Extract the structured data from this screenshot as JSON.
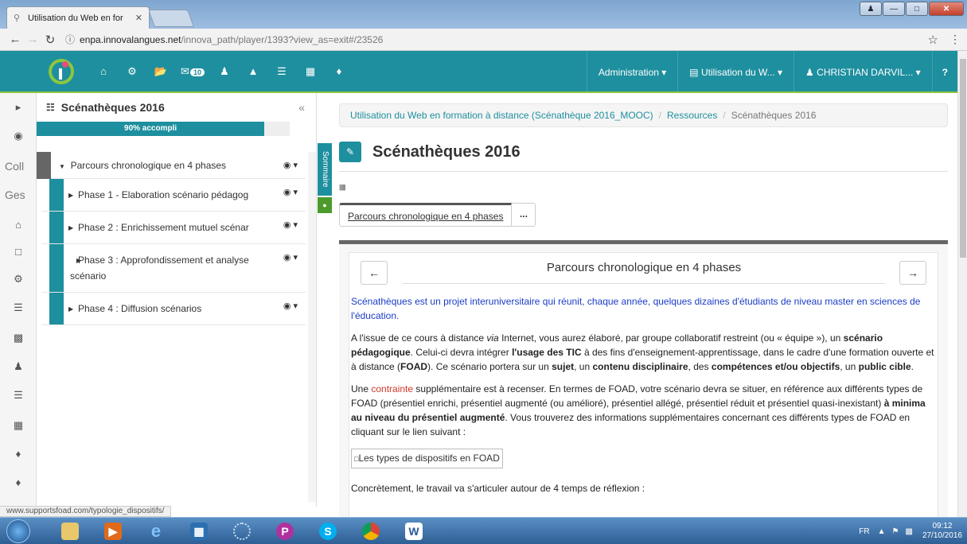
{
  "browser": {
    "tab_title": "Utilisation du Web en for",
    "url_host": "enpa.innovalangues.net",
    "url_path": "/innova_path/player/1393?view_as=exit#/23526",
    "status_url": "www.supportsfoad.com/typologie_dispositifs/"
  },
  "navbar": {
    "messages_count": "10",
    "admin_label": "Administration",
    "course_label": "Utilisation du W...",
    "user_label": "CHRISTIAN DARVIL..."
  },
  "rail": {
    "text1": "Coll",
    "text2": "Ges"
  },
  "sidebar": {
    "title": "Scénathèques 2016",
    "progress_label": "90% accompli",
    "progress_value": 90,
    "root_label": "Parcours chronologique en 4 phases",
    "items": [
      {
        "label": "Phase 1 - Elaboration scénario pédagog"
      },
      {
        "label": "Phase 2 : Enrichissement mutuel scénar"
      },
      {
        "label": "Phase 3 : Approfondissement et analyse scénario"
      },
      {
        "label": "Phase 4 : Diffusion scénarios"
      }
    ]
  },
  "sommaire_label": "Sommaire",
  "breadcrumb": {
    "item1": "Utilisation du Web en formation à distance (Scénathèque 2016_MOOC)",
    "item2": "Ressources",
    "current": "Scénathèques 2016"
  },
  "page_title": "Scénathèques 2016",
  "tab_label": "Parcours chronologique en 4 phases",
  "tab_more": "...",
  "content": {
    "title": "Parcours chronologique en 4 phases",
    "intro": "Scénathèques est un projet interuniversitaire qui réunit, chaque année, quelques dizaines d'étudiants de niveau master en sciences de l'éducation.",
    "p2_a": "A l'issue de ce cours à distance ",
    "p2_via": "via",
    "p2_b": " Internet, vous aurez élaboré, par groupe collaboratif restreint (ou « équipe »), un ",
    "p2_scenario": "scénario pédagogique",
    "p2_c": ". Celui-ci devra intégrer ",
    "p2_tic": "l'usage des TIC",
    "p2_d": " à des fins d'enseignement-apprentissage, dans le cadre d'une formation ouverte et à distance (",
    "p2_foad": "FOAD",
    "p2_e": "). Ce scénario portera sur un ",
    "p2_sujet": "sujet",
    "p2_f": ", un ",
    "p2_contenu": "contenu disciplinaire",
    "p2_g": ", des ",
    "p2_comp": "compétences et/ou objectifs",
    "p2_h": ", un ",
    "p2_public": "public cible",
    "p2_i": ".",
    "p3_a": "Une ",
    "p3_contrainte": "contrainte",
    "p3_b": " supplémentaire est à recenser. En termes de FOAD, votre scénario devra se situer, en référence aux différents types de FOAD (présentiel enrichi, présentiel augmenté (ou amélioré), présentiel allégé, présentiel réduit et présentiel quasi-inexistant) ",
    "p3_minima": "à minima au niveau du présentiel augmenté",
    "p3_c": ". Vous trouverez des informations supplémentaires concernant ces différents types de FOAD en cliquant sur le lien suivant :",
    "image_alt": "Les types de dispositifs en FOAD",
    "p4": "Concrètement, le travail va s'articuler autour de 4 temps de réflexion :"
  },
  "taskbar": {
    "lang": "FR",
    "time": "09:12",
    "date": "27/10/2016"
  },
  "colors": {
    "brand": "#1e8f9e",
    "accent_green": "#8dc63f",
    "intro_blue": "#1a3cc8",
    "contrainte_red": "#d03a2a"
  }
}
